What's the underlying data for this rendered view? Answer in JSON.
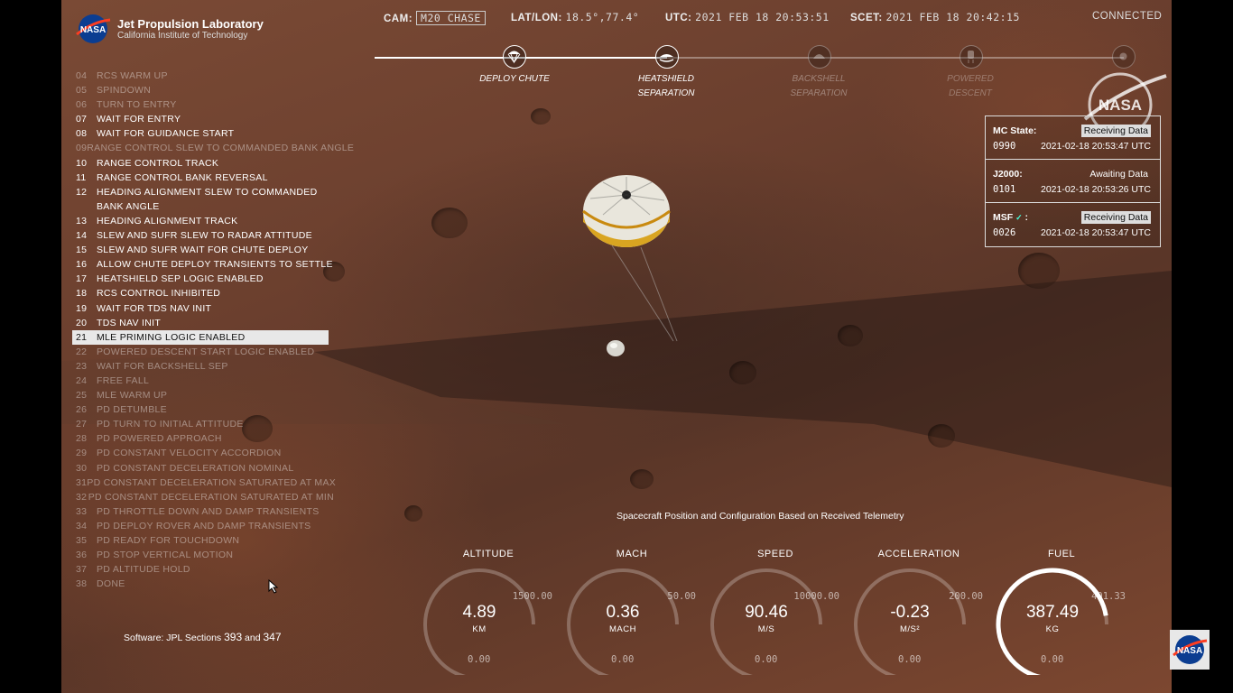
{
  "header": {
    "org_title": "Jet Propulsion Laboratory",
    "org_subtitle": "California Institute of Technology",
    "nasa_text": "NASA",
    "cam_label": "CAM:",
    "cam_value": "M20 CHASE",
    "latlon_label": "LAT/LON:",
    "latlon_value": "18.5°,77.4°",
    "utc_label": "UTC:",
    "utc_value": "2021 FEB 18 20:53:51",
    "scet_label": "SCET:",
    "scet_value": "2021 FEB 18 20:42:15",
    "connection": "CONNECTED"
  },
  "timeline": {
    "stages": [
      {
        "label": "DEPLOY CHUTE",
        "icon": "parachute-icon",
        "state": "done"
      },
      {
        "label": "HEATSHIELD SEPARATION",
        "icon": "heatshield-icon",
        "state": "done"
      },
      {
        "label": "BACKSHELL SEPARATION",
        "icon": "backshell-icon",
        "state": "pending"
      },
      {
        "label": "POWERED DESCENT",
        "icon": "powered-descent-icon",
        "state": "pending"
      },
      {
        "label": "",
        "icon": "touchdown-icon",
        "state": "pending"
      }
    ]
  },
  "events": [
    {
      "num": "04",
      "text": "RCS WARM UP",
      "state": "pending"
    },
    {
      "num": "05",
      "text": "SPINDOWN",
      "state": "pending"
    },
    {
      "num": "06",
      "text": "TURN TO ENTRY",
      "state": "pending"
    },
    {
      "num": "07",
      "text": "WAIT FOR ENTRY",
      "state": "done"
    },
    {
      "num": "08",
      "text": "WAIT FOR GUIDANCE START",
      "state": "done"
    },
    {
      "num": "09",
      "text": "RANGE CONTROL SLEW TO COMMANDED BANK ANGLE",
      "state": "pending"
    },
    {
      "num": "10",
      "text": "RANGE CONTROL TRACK",
      "state": "done"
    },
    {
      "num": "11",
      "text": "RANGE CONTROL BANK REVERSAL",
      "state": "done"
    },
    {
      "num": "12",
      "text": "HEADING ALIGNMENT SLEW TO COMMANDED BANK ANGLE",
      "state": "done"
    },
    {
      "num": "13",
      "text": "HEADING ALIGNMENT TRACK",
      "state": "done"
    },
    {
      "num": "14",
      "text": "SLEW AND SUFR SLEW TO RADAR ATTITUDE",
      "state": "done"
    },
    {
      "num": "15",
      "text": "SLEW AND SUFR WAIT FOR CHUTE DEPLOY",
      "state": "done"
    },
    {
      "num": "16",
      "text": "ALLOW CHUTE DEPLOY TRANSIENTS TO SETTLE",
      "state": "done"
    },
    {
      "num": "17",
      "text": "HEATSHIELD SEP LOGIC ENABLED",
      "state": "done"
    },
    {
      "num": "18",
      "text": "RCS CONTROL INHIBITED",
      "state": "done"
    },
    {
      "num": "19",
      "text": "WAIT FOR TDS NAV INIT",
      "state": "done"
    },
    {
      "num": "20",
      "text": "TDS NAV INIT",
      "state": "done"
    },
    {
      "num": "21",
      "text": "MLE PRIMING LOGIC ENABLED",
      "state": "active"
    },
    {
      "num": "22",
      "text": "POWERED DESCENT START LOGIC ENABLED",
      "state": "pending"
    },
    {
      "num": "23",
      "text": "WAIT FOR BACKSHELL SEP",
      "state": "pending"
    },
    {
      "num": "24",
      "text": "FREE FALL",
      "state": "pending"
    },
    {
      "num": "25",
      "text": "MLE WARM UP",
      "state": "pending"
    },
    {
      "num": "26",
      "text": "PD DETUMBLE",
      "state": "pending"
    },
    {
      "num": "27",
      "text": "PD TURN TO INITIAL ATTITUDE",
      "state": "pending"
    },
    {
      "num": "28",
      "text": "PD POWERED APPROACH",
      "state": "pending"
    },
    {
      "num": "29",
      "text": "PD CONSTANT VELOCITY ACCORDION",
      "state": "pending"
    },
    {
      "num": "30",
      "text": "PD CONSTANT DECELERATION NOMINAL",
      "state": "pending"
    },
    {
      "num": "31",
      "text": "PD CONSTANT DECELERATION SATURATED AT MAX",
      "state": "pending"
    },
    {
      "num": "32",
      "text": "PD CONSTANT DECELERATION SATURATED AT MIN",
      "state": "pending"
    },
    {
      "num": "33",
      "text": "PD THROTTLE DOWN AND DAMP TRANSIENTS",
      "state": "pending"
    },
    {
      "num": "34",
      "text": "PD DEPLOY ROVER AND DAMP TRANSIENTS",
      "state": "pending"
    },
    {
      "num": "35",
      "text": "PD READY FOR TOUCHDOWN",
      "state": "pending"
    },
    {
      "num": "36",
      "text": "PD STOP VERTICAL MOTION",
      "state": "pending"
    },
    {
      "num": "37",
      "text": "PD ALTITUDE HOLD",
      "state": "pending"
    },
    {
      "num": "38",
      "text": "DONE",
      "state": "pending"
    }
  ],
  "software": {
    "prefix": "Software: JPL Sections",
    "a": "393",
    "and": "and",
    "b": "347"
  },
  "status": [
    {
      "label": "MC State:",
      "state": "Receiving Data",
      "receiving": true,
      "count": "0990",
      "time": "2021-02-18 20:53:47 UTC",
      "check": false
    },
    {
      "label": "J2000:",
      "state": "Awaiting Data",
      "receiving": false,
      "count": "0101",
      "time": "2021-02-18 20:53:26 UTC",
      "check": false
    },
    {
      "label": "MSF",
      "state": "Receiving Data",
      "receiving": true,
      "count": "0026",
      "time": "2021-02-18 20:53:47 UTC",
      "check": true
    }
  ],
  "caption": "Spacecraft Position and Configuration Based on Received Telemetry",
  "gauges": [
    {
      "title": "ALTITUDE",
      "value": "4.89",
      "unit": "KM",
      "max": "1500.00",
      "min": "0.00",
      "fraction": 0.0033
    },
    {
      "title": "MACH",
      "value": "0.36",
      "unit": "MACH",
      "max": "50.00",
      "min": "0.00",
      "fraction": 0.0072
    },
    {
      "title": "SPEED",
      "value": "90.46",
      "unit": "M/S",
      "max": "10000.00",
      "min": "0.00",
      "fraction": 0.009
    },
    {
      "title": "ACCELERATION",
      "value": "-0.23",
      "unit": "M/S²",
      "max": "200.00",
      "min": "0.00",
      "fraction": 0.0
    },
    {
      "title": "FUEL",
      "value": "387.49",
      "unit": "KG",
      "max": "401.33",
      "min": "0.00",
      "fraction": 0.9655
    }
  ],
  "colors": {
    "accent": "#ffffff",
    "dim": "rgba(255,255,255,0.4)",
    "chute_gold": "#d9a521",
    "mars": "#6b3f2e"
  }
}
